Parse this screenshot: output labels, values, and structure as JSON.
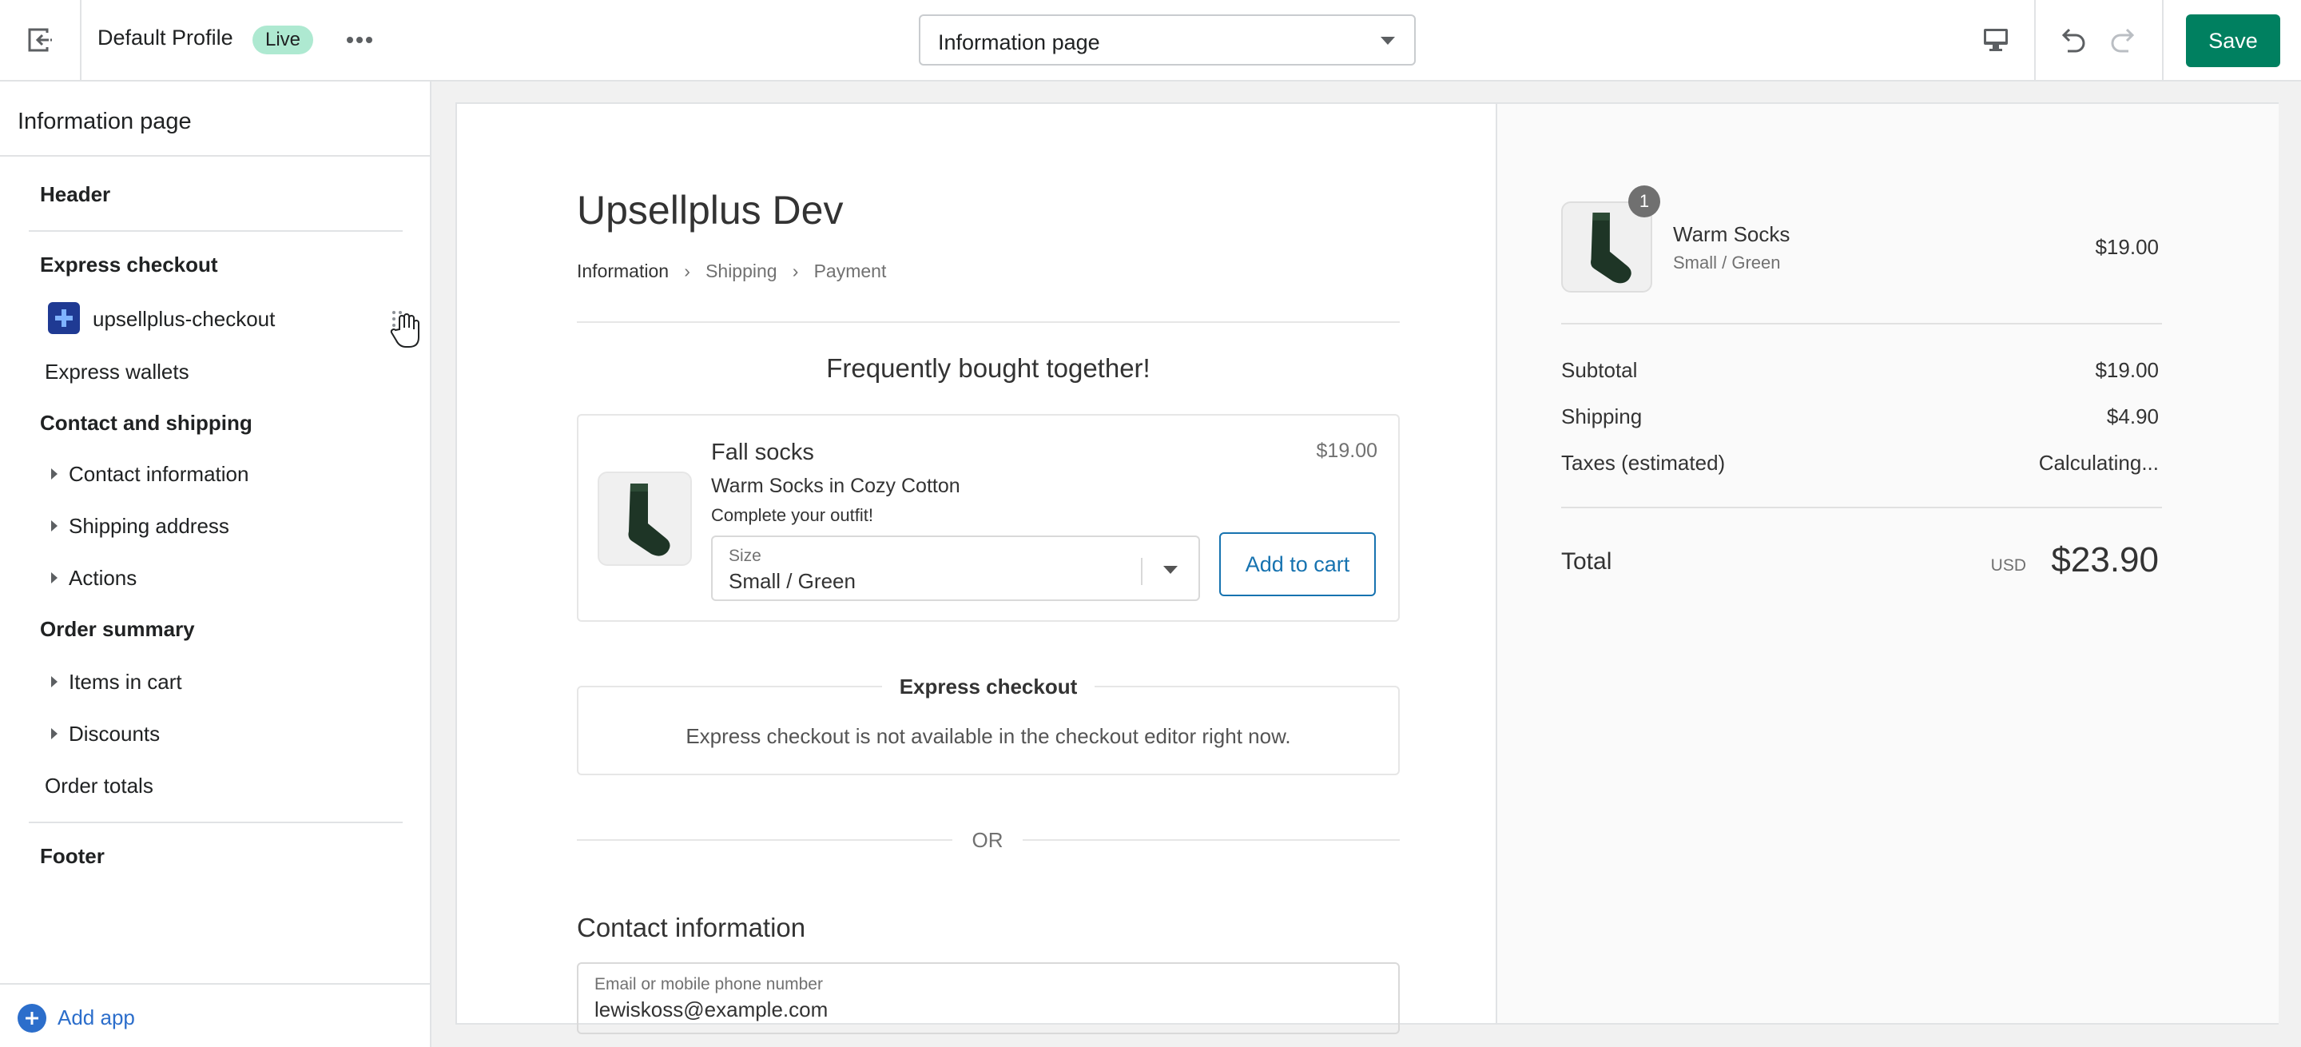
{
  "topbar": {
    "profile_name": "Default Profile",
    "status_badge": "Live",
    "page_select_value": "Information page",
    "save_label": "Save",
    "icons": [
      "exit-icon",
      "more-horizontal-icon",
      "desktop-icon",
      "undo-icon",
      "redo-icon"
    ]
  },
  "sidebar": {
    "title": "Information page",
    "header": "Header",
    "express_checkout": "Express checkout",
    "app_block": "upsellplus-checkout",
    "express_wallets": "Express wallets",
    "contact_shipping": "Contact and shipping",
    "contact_information": "Contact information",
    "shipping_address": "Shipping address",
    "actions": "Actions",
    "order_summary": "Order summary",
    "items_in_cart": "Items in cart",
    "discounts": "Discounts",
    "order_totals": "Order totals",
    "footer": "Footer",
    "add_app": "Add app"
  },
  "preview": {
    "shop_title": "Upsellplus Dev",
    "breadcrumbs": [
      "Information",
      "Shipping",
      "Payment"
    ],
    "upsell": {
      "heading": "Frequently bought together!",
      "product_name": "Fall socks",
      "product_subtitle": "Warm Socks in Cozy Cotton",
      "product_description": "Complete your outfit!",
      "price": "$19.00",
      "size_label": "Size",
      "size_value": "Small / Green",
      "add_to_cart": "Add to cart"
    },
    "express": {
      "legend": "Express checkout",
      "message": "Express checkout is not available in the checkout editor right now."
    },
    "or_divider": "OR",
    "contact": {
      "title": "Contact information",
      "email_label": "Email or mobile phone number",
      "email_value": "lewiskoss@example.com"
    }
  },
  "summary": {
    "item": {
      "quantity": "1",
      "name": "Warm Socks",
      "variant": "Small / Green",
      "price": "$19.00"
    },
    "subtotal_label": "Subtotal",
    "subtotal_value": "$19.00",
    "shipping_label": "Shipping",
    "shipping_value": "$4.90",
    "taxes_label": "Taxes (estimated)",
    "taxes_value": "Calculating...",
    "total_label": "Total",
    "total_currency": "USD",
    "total_value": "$23.90"
  },
  "colors": {
    "accent": "#008060",
    "link": "#2c6ecb",
    "live_badge": "#aee9d1",
    "button_outline": "#1773b0"
  }
}
